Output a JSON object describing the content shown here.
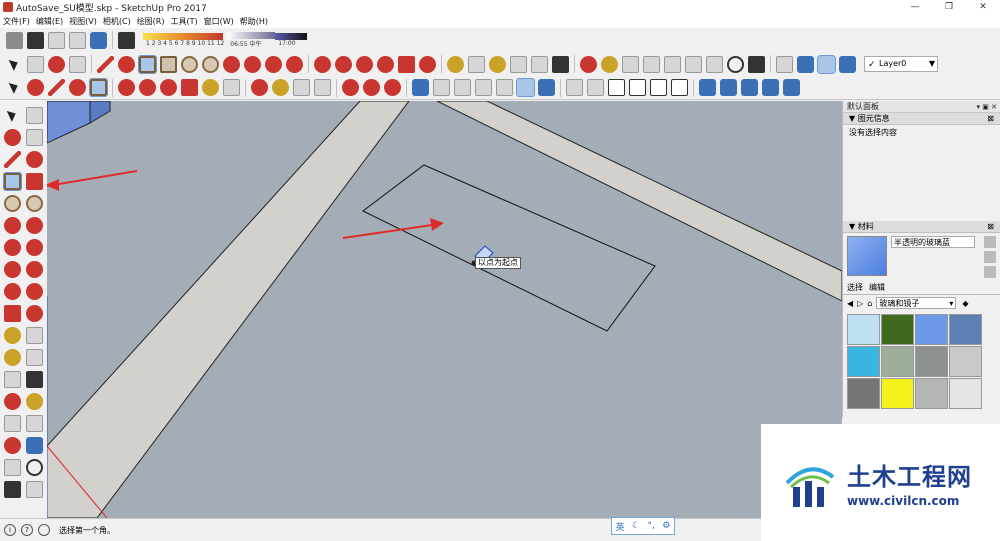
{
  "window": {
    "title": "AutoSave_SU模型.skp - SketchUp Pro 2017",
    "controls": [
      "—",
      "❐",
      "✕"
    ]
  },
  "menu": [
    "文件(F)",
    "编辑(E)",
    "视图(V)",
    "相机(C)",
    "绘图(R)",
    "工具(T)",
    "窗口(W)",
    "帮助(H)"
  ],
  "shadow_bar": {
    "months": "1 2 3 4 5 6 7 8 9 10 11 12",
    "time_start": "06:55",
    "time_mid": "中午",
    "time_end": "17:00"
  },
  "layer": {
    "current": "Layer0"
  },
  "tooltip": "以点为起点",
  "right_panel": {
    "title": "默认面板",
    "entity_info": {
      "header": "图元信息",
      "content": "没有选择内容"
    },
    "materials": {
      "header": "材料",
      "current_name": "半透明的玻璃蓝",
      "tab_select": "选择",
      "tab_edit": "编辑",
      "category": "玻璃和镜子",
      "swatches": [
        "#bfe0f2",
        "#3f6a1e",
        "#6d9ae8",
        "#5e7fb3",
        "#38b6e0",
        "#9fae9a",
        "#8d9190",
        "#c9c9c9",
        "#757575",
        "#f4f21a",
        "#b5b5b5",
        "#e4e4e4"
      ]
    }
  },
  "status": {
    "text": "选择第一个角。",
    "icons": [
      "i",
      "?"
    ]
  },
  "ime": {
    "label": "英",
    "moon": "☾",
    "punct": "°,",
    "gear": "⚙"
  },
  "watermark": {
    "name": "土木工程网",
    "url": "www.civilcn.com"
  }
}
